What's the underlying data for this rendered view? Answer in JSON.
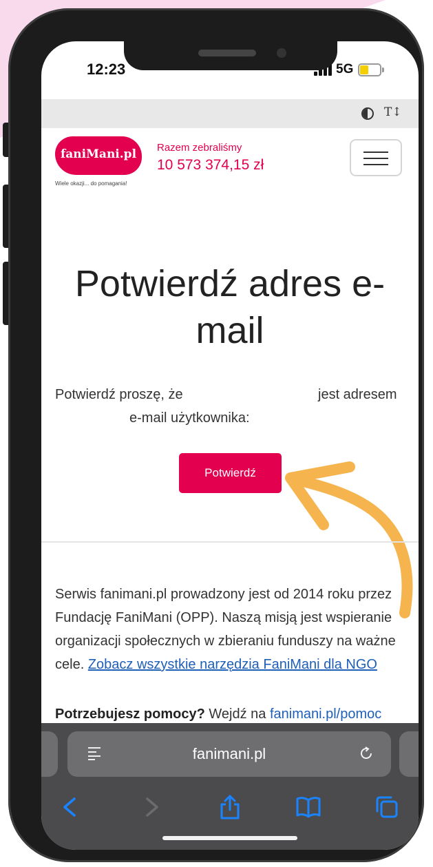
{
  "status_bar": {
    "time": "12:23",
    "network": "5G"
  },
  "site": {
    "logo_text": "faniMani.pl",
    "tagline": "Wiele okazji... do pomagania!",
    "raised_label": "Razem zebraliśmy",
    "raised_amount": "10 573 374,15 zł"
  },
  "main": {
    "heading": "Potwierdź adres e-mail",
    "confirm_text_start": "Potwierdź proszę, że",
    "confirm_text_end": "jest adresem",
    "confirm_text_line2": "e-mail użytkownika:",
    "confirm_button": "Potwierdź"
  },
  "footer": {
    "about_text": "Serwis fanimani.pl prowadzony jest od 2014 roku przez Fundację FaniMani (OPP). Naszą misją jest wspieranie organizacji społecznych w zbieraniu funduszy na ważne cele.",
    "tools_link": "Zobacz wszystkie narzędzia FaniMani dla NGO",
    "help_label": "Potrzebujesz pomocy?",
    "help_text": "Wejdź na",
    "help_link": "fanimani.pl/pomoc"
  },
  "browser": {
    "url": "fanimani.pl"
  },
  "colors": {
    "brand": "#e2004f",
    "link": "#1e5fb8",
    "arrow": "#f6b44f",
    "decor_pink": "#f9d9ec"
  }
}
